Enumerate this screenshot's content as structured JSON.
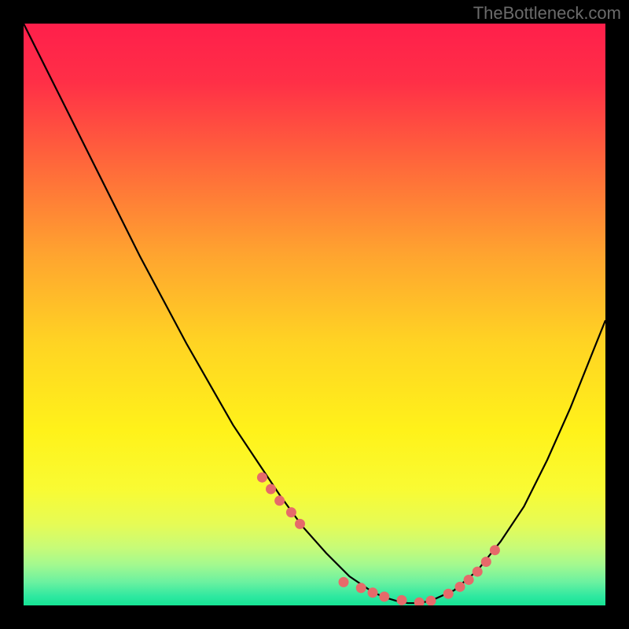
{
  "watermark": "TheBottleneck.com",
  "chart_data": {
    "type": "line",
    "title": "",
    "xlabel": "",
    "ylabel": "",
    "xlim": [
      0,
      100
    ],
    "ylim": [
      0,
      100
    ],
    "series": [
      {
        "name": "curve",
        "x": [
          0,
          4,
          8,
          12,
          16,
          20,
          24,
          28,
          32,
          36,
          40,
          44,
          48,
          52,
          56,
          60,
          62,
          64,
          66,
          68,
          70,
          74,
          78,
          82,
          86,
          90,
          94,
          98,
          100
        ],
        "y": [
          100,
          92,
          84,
          76,
          68,
          60,
          52.5,
          45,
          38,
          31,
          25,
          19,
          13.5,
          9,
          5,
          2.3,
          1.4,
          0.8,
          0.4,
          0.4,
          0.8,
          2.6,
          6,
          11,
          17,
          25,
          34,
          44,
          49
        ]
      }
    ],
    "markers": {
      "name": "highlight-points",
      "color": "#e66a6a",
      "x": [
        41,
        42.5,
        44,
        46,
        47.5,
        55,
        58,
        60,
        62,
        65,
        68,
        70,
        73,
        75,
        76.5,
        78,
        79.5,
        81
      ],
      "y": [
        22,
        20,
        18,
        16,
        14,
        4,
        3,
        2.2,
        1.5,
        0.9,
        0.5,
        0.8,
        2.0,
        3.2,
        4.4,
        5.8,
        7.5,
        9.5
      ]
    },
    "background_gradient": {
      "stops": [
        {
          "pos": 0.0,
          "color": "#ff1f4b"
        },
        {
          "pos": 0.1,
          "color": "#ff2f47"
        },
        {
          "pos": 0.25,
          "color": "#ff6b3a"
        },
        {
          "pos": 0.4,
          "color": "#ffa52f"
        },
        {
          "pos": 0.55,
          "color": "#ffd423"
        },
        {
          "pos": 0.7,
          "color": "#fff21a"
        },
        {
          "pos": 0.8,
          "color": "#f9fb33"
        },
        {
          "pos": 0.86,
          "color": "#e6fb55"
        },
        {
          "pos": 0.9,
          "color": "#c8fb77"
        },
        {
          "pos": 0.93,
          "color": "#a3f98f"
        },
        {
          "pos": 0.96,
          "color": "#6bf1a0"
        },
        {
          "pos": 0.985,
          "color": "#2de8a0"
        },
        {
          "pos": 1.0,
          "color": "#16e495"
        }
      ]
    }
  }
}
